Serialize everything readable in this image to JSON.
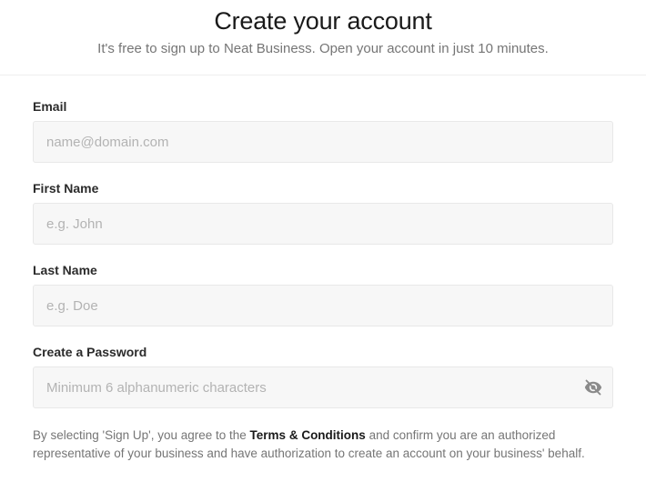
{
  "header": {
    "title": "Create your account",
    "subtitle": "It's free to sign up to Neat Business. Open your account in just 10 minutes."
  },
  "form": {
    "email": {
      "label": "Email",
      "placeholder": "name@domain.com"
    },
    "first_name": {
      "label": "First Name",
      "placeholder": "e.g. John"
    },
    "last_name": {
      "label": "Last Name",
      "placeholder": "e.g. Doe"
    },
    "password": {
      "label": "Create a Password",
      "placeholder": "Minimum 6 alphanumeric characters"
    }
  },
  "terms": {
    "pre": "By selecting 'Sign Up', you agree to the ",
    "link": "Terms & Conditions",
    "post": " and confirm you are an authorized representative of your business and have authorization to create an account on your business' behalf."
  }
}
